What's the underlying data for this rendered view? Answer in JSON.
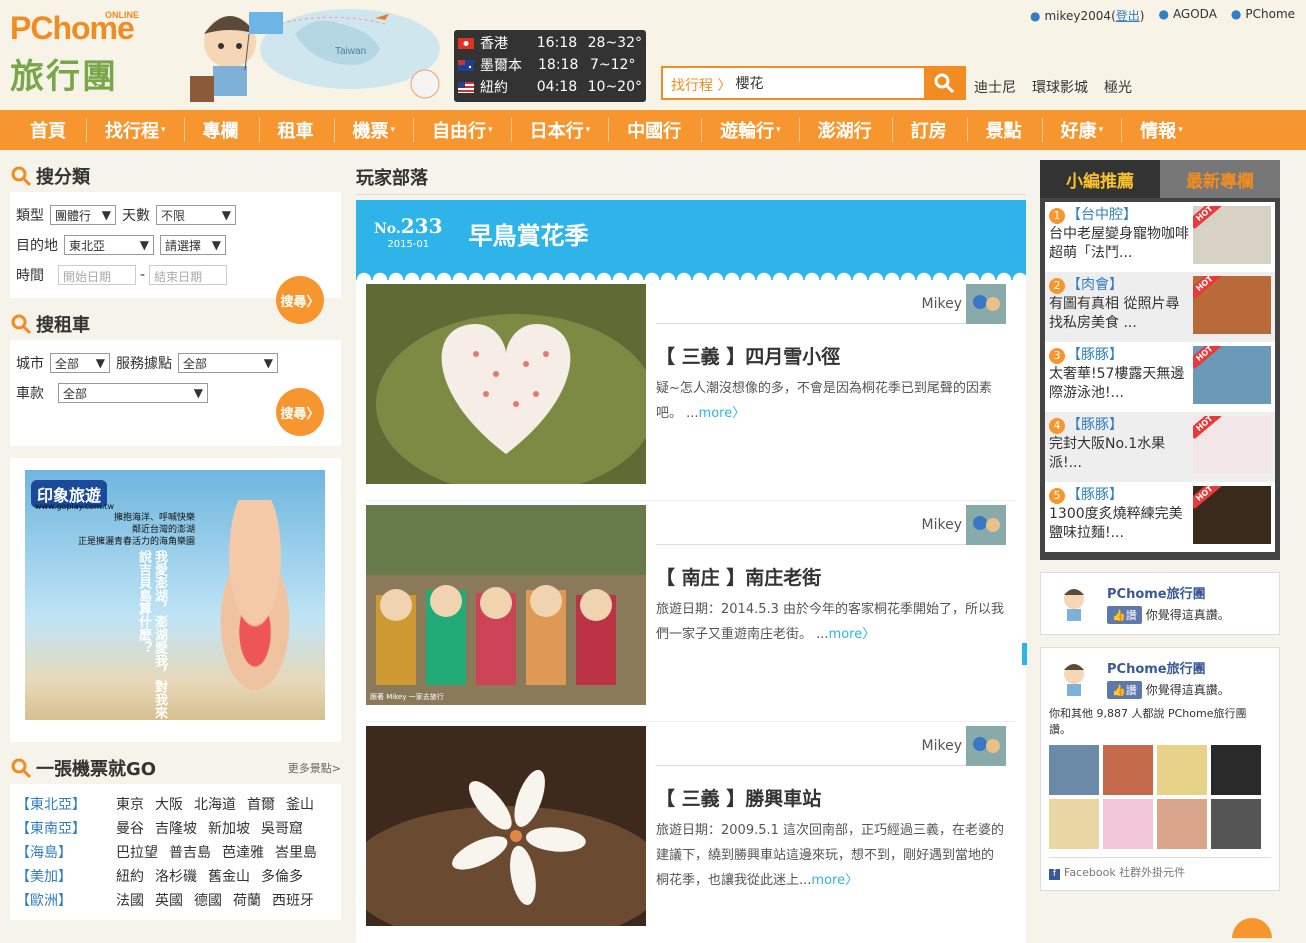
{
  "header": {
    "logo_brand": "PChome",
    "logo_online": "ONLINE",
    "logo_sub": "旅行團",
    "map_label": "Taiwan",
    "user": "mikey2004",
    "logout": "登出",
    "link1": "AGODA",
    "link2": "PChome",
    "search_tag": "找行程",
    "search_value": "櫻花",
    "hot": [
      "迪士尼",
      "環球影城",
      "極光"
    ]
  },
  "weather": [
    {
      "city": "香港",
      "time": "16:18",
      "temp": "28~32°"
    },
    {
      "city": "墨爾本",
      "time": "18:18",
      "temp": "7~12°"
    },
    {
      "city": "紐約",
      "time": "04:18",
      "temp": "10~20°"
    }
  ],
  "nav": [
    {
      "label": "首頁",
      "dd": ""
    },
    {
      "label": "找行程",
      "dd": "▾"
    },
    {
      "label": "專欄",
      "dd": ""
    },
    {
      "label": "租車",
      "dd": ""
    },
    {
      "label": "機票",
      "dd": "▾"
    },
    {
      "label": "自由行",
      "dd": "▾"
    },
    {
      "label": "日本行",
      "dd": "▾"
    },
    {
      "label": "中國行",
      "dd": ""
    },
    {
      "label": "遊輪行",
      "dd": "▾"
    },
    {
      "label": "澎湖行",
      "dd": ""
    },
    {
      "label": "訂房",
      "dd": ""
    },
    {
      "label": "景點",
      "dd": ""
    },
    {
      "label": "好康",
      "dd": "▾"
    },
    {
      "label": "情報",
      "dd": "▾"
    }
  ],
  "search_cat": {
    "title": "搜分類",
    "type_label": "類型",
    "type_val": "團體行",
    "days_label": "天數",
    "days_val": "不限",
    "dest_label": "目的地",
    "dest_val": "東北亞",
    "dest2_val": "請選擇",
    "time_label": "時間",
    "start_ph": "開始日期",
    "end_ph": "結束日期",
    "btn": "搜尋"
  },
  "search_car": {
    "title": "搜租車",
    "city_label": "城市",
    "city_val": "全部",
    "svc_label": "服務據點",
    "svc_val": "全部",
    "model_label": "車款",
    "model_val": "全部",
    "btn": "搜尋"
  },
  "ad": {
    "brand": "印象旅遊",
    "url": "www.goplay.com.tw",
    "l1": "擁抱海洋、呼喊快樂",
    "l2": "鄰近台灣的澎湖",
    "l3": "正是擁灑青春活力的海角樂園",
    "v1": "我愛澎湖，澎湖愛我，",
    "v2": "對我來說吉貝島算什麼？"
  },
  "tickets": {
    "title": "一張機票就GO",
    "more": "更多景點>",
    "rows": [
      {
        "region": "【東北亞】",
        "cities": [
          "東京",
          "大阪",
          "北海道",
          "首爾",
          "釜山"
        ]
      },
      {
        "region": "【東南亞】",
        "cities": [
          "曼谷",
          "吉隆坡",
          "新加坡",
          "吳哥窟"
        ]
      },
      {
        "region": "【海島】",
        "cities": [
          "巴拉望",
          "普吉島",
          "芭達雅",
          "峇里島"
        ]
      },
      {
        "region": "【美加】",
        "cities": [
          "紐約",
          "洛杉磯",
          "舊金山",
          "多倫多"
        ]
      },
      {
        "region": "【歐洲】",
        "cities": [
          "法國",
          "英國",
          "德國",
          "荷蘭",
          "西班牙"
        ]
      }
    ]
  },
  "blog": {
    "title": "玩家部落",
    "no_prefix": "No.",
    "no": "233",
    "date": "2015-01",
    "banner_title": "早鳥賞花季",
    "posts": [
      {
        "author": "Mikey",
        "title": "【 三義 】四月雪小徑",
        "desc": "疑~怎人潮沒想像的多，不會是因為桐花季已到尾聲的因素吧。 ...",
        "more": "more〉"
      },
      {
        "author": "Mikey",
        "title": "【 南庄 】南庄老街",
        "desc": "旅遊日期：2014.5.3 由於今年的客家桐花季開始了，所以我們一家子又重遊南庄老街。 ...",
        "more": "more〉",
        "credit": "跟著 Mikey 一家去旅行"
      },
      {
        "author": "Mikey",
        "title": "【 三義 】勝興車站",
        "desc": "旅遊日期：2009.5.1 這次回南部，正巧經過三義，在老婆的建議下，繞到勝興車站這邊來玩，想不到，剛好遇到當地的桐花季，也讓我從此迷上...",
        "more": "more〉"
      }
    ]
  },
  "right": {
    "tab1": "小編推薦",
    "tab2": "最新專欄",
    "picks": [
      {
        "n": "1",
        "cat": "【台中腔】",
        "text": "台中老屋變身寵物咖啡 超萌「法鬥..."
      },
      {
        "n": "2",
        "cat": "【肉會】",
        "text": "有圖有真相 從照片尋找私房美食 ..."
      },
      {
        "n": "3",
        "cat": "【豚豚】",
        "text": "太奢華!57樓露天無邊際游泳池!..."
      },
      {
        "n": "4",
        "cat": "【豚豚】",
        "text": "完封大阪No.1水果派!..."
      },
      {
        "n": "5",
        "cat": "【豚豚】",
        "text": "1300度炙燒粹練完美鹽味拉麵!..."
      }
    ],
    "hot": "HOT",
    "fb_name": "PChome旅行團",
    "fb_like": "讚",
    "fb_like_text": "你覺得這真讚。",
    "fb_fans": "你和其他 9,887 人都說 PChome旅行團 讚。",
    "fb_footer": "Facebook 社群外掛元件"
  }
}
